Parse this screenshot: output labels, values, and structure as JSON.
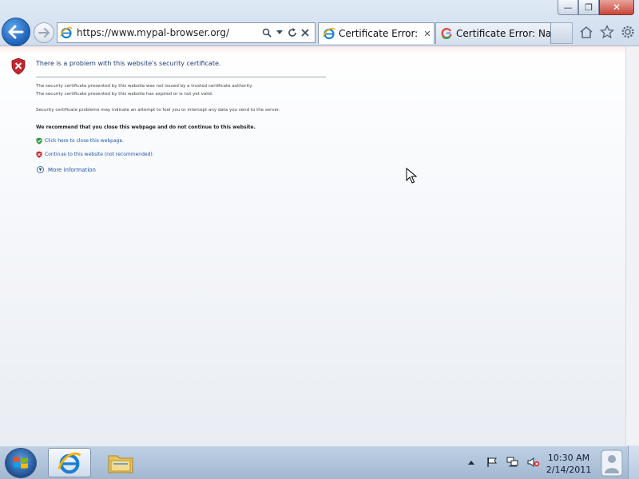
{
  "window": {
    "caption": {
      "minimize": "—",
      "maximize": "❐",
      "close": "✕"
    }
  },
  "nav": {
    "address_url": "https://www.mypal-browser.org/",
    "tabs": [
      {
        "title": "Certificate Error: ...",
        "icon": "ie-icon",
        "active": true,
        "close": "✕"
      },
      {
        "title": "Certificate Error: Na...",
        "icon": "google-icon",
        "active": false
      }
    ]
  },
  "page": {
    "title": "There is a problem with this website's security certificate.",
    "paragraph1": [
      "The security certificate presented by this website was not issued by a trusted certificate authority.",
      "The security certificate presented by this website has expired or is not yet valid."
    ],
    "paragraph2": "Security certificate problems may indicate an attempt to fool you or intercept any data you send to the server.",
    "recommendation": "We recommend that you close this webpage and do not continue to this website.",
    "close_link": "Click here to close this webpage.",
    "continue_link": "Continue to this website (not recommended).",
    "more_info": "More information"
  },
  "taskbar": {
    "clock_time": "10:30 AM",
    "clock_date": "2/14/2011"
  },
  "colors": {
    "link": "#1f56a8",
    "title": "#1f3c7a",
    "shield_red": "#c8242c",
    "shield_green": "#2f9b3a"
  }
}
